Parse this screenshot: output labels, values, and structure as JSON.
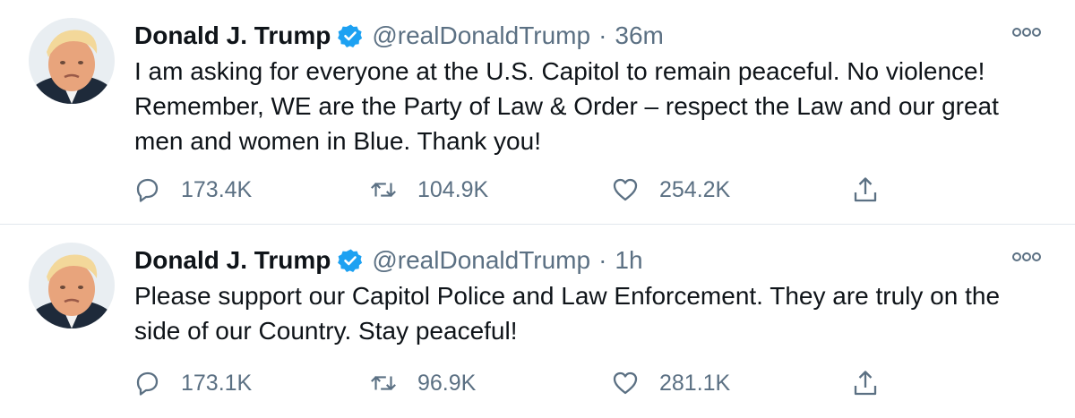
{
  "tweets": [
    {
      "author_name": "Donald J. Trump",
      "handle": "@realDonaldTrump",
      "separator": "·",
      "time": "36m",
      "text": "I am asking for everyone at the U.S. Capitol to remain peaceful. No violence! Remember, WE are the Party of Law & Order – respect the Law and our great men and women in Blue. Thank you!",
      "replies": "173.4K",
      "retweets": "104.9K",
      "likes": "254.2K"
    },
    {
      "author_name": "Donald J. Trump",
      "handle": "@realDonaldTrump",
      "separator": "·",
      "time": "1h",
      "text": "Please support our Capitol Police and Law Enforcement. They are truly on the side of our Country. Stay peaceful!",
      "replies": "173.1K",
      "retweets": "96.9K",
      "likes": "281.1K"
    }
  ],
  "icons": {
    "verified": "verified-badge-icon",
    "more": "more-options-icon",
    "reply": "reply-icon",
    "retweet": "retweet-icon",
    "like": "like-icon",
    "share": "share-icon"
  },
  "colors": {
    "text": "#0f1419",
    "secondary": "#5b7083",
    "verified": "#1da1f2",
    "divider": "#e1e8ed"
  }
}
